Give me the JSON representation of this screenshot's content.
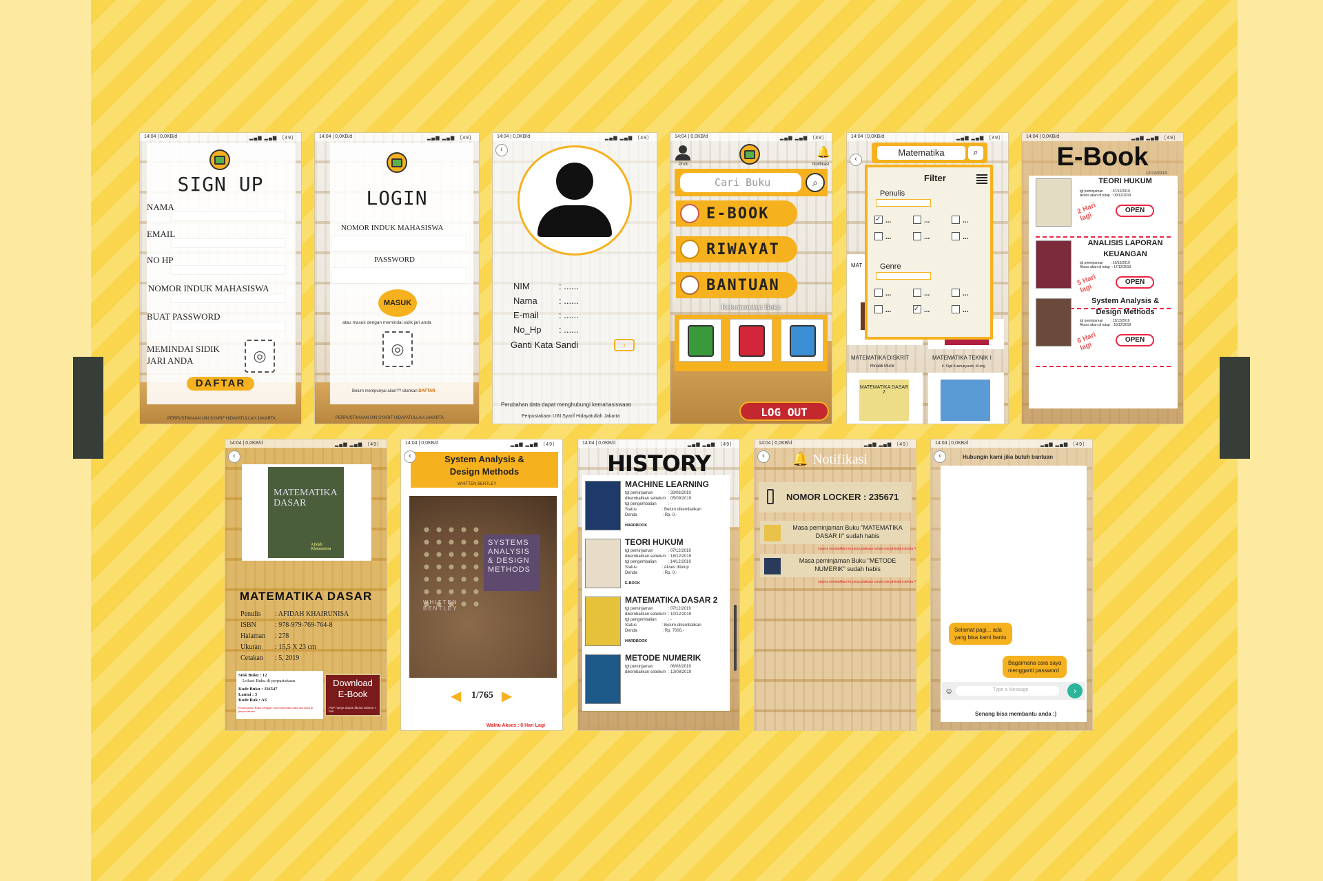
{
  "status_bar": {
    "time": "14:04 | 0,0KB/d",
    "signal": "▂▄▆ ▂▄▆ 〔49〕"
  },
  "signup": {
    "title": "SIGN UP",
    "fields": [
      "NAMA",
      "EMAIL",
      "NO HP",
      "NOMOR INDUK MAHASISWA",
      "BUAT PASSWORD"
    ],
    "fingerprint_label": "MEMINDAI SIDIK\nJARI ANDA",
    "button": "DAFTAR",
    "footer": "PERPUSTAKAAN UIN SYARIF HIDAYATULLAH JAKARTA"
  },
  "login": {
    "title": "LOGIN",
    "nim_label": "NOMOR INDUK MAHASISWA",
    "password_label": "PASSWORD",
    "button": "MASUK",
    "fingerprint_hint": "atau masuk dengan memindai sidik jari anda",
    "register_hint": "Belum mempunyai akun?? silahkan",
    "register_link": "DAFTAR",
    "footer": "PERPUSTAKAAN UIN SYARIF HIDAYATULLAH JAKARTA"
  },
  "profile": {
    "rows": [
      {
        "label": "NIM",
        "value": ": ......"
      },
      {
        "label": "Nama",
        "value": ": ......"
      },
      {
        "label": "E-mail",
        "value": ": ......"
      },
      {
        "label": "No_Hp",
        "value": ": ......"
      }
    ],
    "change_password": "Ganti Kata Sandi",
    "note": "Perubahan data dapat menghubungi kemahasiswaan",
    "footer": "Perpustakaan UIN Syarif Hidayatullah Jakarta"
  },
  "home": {
    "profile_label": "Profil",
    "notif_label": "Notifikasi",
    "search_placeholder": "Cari Buku",
    "menu": [
      "E-BOOK",
      "RIWAYAT",
      "BANTUAN"
    ],
    "recommend": "Rekomendasi Buku",
    "logout": "LOG OUT"
  },
  "search": {
    "query": "Matematika",
    "filter_title": "Filter",
    "penulis": "Penulis",
    "genre": "Genre",
    "option": "...",
    "results": [
      {
        "title": "MATEMATIKA DISKRIT",
        "author": "Rinaldi Munir"
      },
      {
        "title": "MATEMATIKA TEKNIK I",
        "author": "Ir. Sigit Kusmaryanto, M.eng"
      }
    ],
    "partial_label": "MAT",
    "cover_label": "MATEMATIKA DASAR 2",
    "cover_label2": "TEKNIK I"
  },
  "ebook": {
    "title": "E-Book",
    "date": "12/12/2019",
    "items": [
      {
        "title": "TEORI HUKUM",
        "borrow": "tgl peminjaman        : 07/12/2019",
        "close": "Akses akan di tutup  : 09/12/2019",
        "days": "2 Hari\nlagi",
        "open": "OPEN"
      },
      {
        "title": "ANALISIS LAPORAN\nKEUANGAN",
        "borrow": "tgl peminjaman        : 10/12/2019",
        "close": "Akses akan di tutup  : 17/12/2019",
        "days": "5 Hari\nlagi",
        "open": "OPEN"
      },
      {
        "title": "System Analysis &\nDesign Methods",
        "borrow": "tgl peminjaman        : 11/12/2019",
        "close": "Akses akan di tutup  : 18/12/2019",
        "days": "6 Hari\nlagi",
        "open": "OPEN"
      }
    ]
  },
  "book_detail": {
    "title": "MATEMATIKA DASAR",
    "cover_title": "MATEMATIKA\nDASAR",
    "cover_author": "Afidah\nKhairunnisa",
    "rows": [
      {
        "label": "Penulis",
        "value": ": AFIDAH KHAIRUNISA"
      },
      {
        "label": "ISBN",
        "value": ": 978-979-769-764-8"
      },
      {
        "label": "Halaman",
        "value": ": 278"
      },
      {
        "label": "Ukuran",
        "value": ": 15,5 X 23 cm"
      },
      {
        "label": "Cetakan",
        "value": ": 5, 2019"
      }
    ],
    "stock": "Stok Buku : 12",
    "location": "Lokasi Buku di perpustakaan",
    "kode_buku": "Kode Buku : J26547",
    "lantai": "Lantai       : 3",
    "kode_rak": "Kode Rak  : AS",
    "warning": "Peminjaman Buku Dengan cara memindai buku dan sidik di perpustakaan",
    "download": "Download\nE-Book",
    "download_note": "PDF hanya dapat dibuka selama 7 hari"
  },
  "reader": {
    "title": "System Analysis &\nDesign Methods",
    "author": "WHITTEN BENTLEY",
    "cover_text": "SYSTEMS\nANALYSIS\n& DESIGN\nMETHODS",
    "cover_author": "WHITTEN\nBENTLEY",
    "page": "1/765",
    "time_left": "Waktu Akses : 6 Hari Lagi"
  },
  "history": {
    "title": "HISTORY",
    "items": [
      {
        "title": "MACHINE LEARNING",
        "info": "tgl peminjaman             : 28/08/2019\ndikembalikan sebelum  : 05/09/2019\ntgl pengembalian          : -\nStatus                      : Belum dikembalikan\nDenda                      : Rp. 0,-",
        "type": "HARDBOOK"
      },
      {
        "title": "TEORI HUKUM",
        "info": "tgl peminjaman             : 07/12/2019\ndikembalikan sebelum  : 18/12/2019\ntgl pengembalian          : 14/12/2019\nStatus                      : Akses ditutup\nDenda                      : Rp. 0,-",
        "type": "E-BOOK"
      },
      {
        "title": "MATEMATIKA DASAR 2",
        "info": "tgl peminjaman             : 07/12/2019\ndikembalikan sebelum  : 10/12/2019\ntgl pengembalian          : -\nStatus                      : Belum dikembalikan\nDenda                      : Rp. 7000,-",
        "type": "HARDBOOK"
      },
      {
        "title": "METODE NUMERIK",
        "info": "tgl peminjaman             : 06/08/2019\ndikembalikan sebelum  : 13/08/2019",
        "type": ""
      }
    ]
  },
  "notifications": {
    "title": "Notifikasi",
    "locker": "NOMOR LOCKER : 235671",
    "items": [
      {
        "text": "Masa peminjaman Buku \"MATEMATIKA DASAR II\" sudah habis",
        "sub": "segera kembalikan ke perpustakaan untuk menghindari denda !!"
      },
      {
        "text": "Masa peminjaman Buku \"METODE NUMERIK\" sudah habis",
        "sub": "segera kembalikan ke perpustakaan untuk menghindari denda !!"
      }
    ]
  },
  "chat": {
    "header": "Hubungin kami jika butuh bantuan",
    "msg_in": "Selamat pagi... ada\nyang bisa kami bantu",
    "msg_out": "Bagaimana cara saya\nmengganti password",
    "placeholder": "Type a Message",
    "footer": "Senang bisa membantu anda :)"
  },
  "colors": {
    "accent": "#f6b11e",
    "panel": "#f9d64e",
    "dark": "#373d37",
    "red": "#e24"
  }
}
